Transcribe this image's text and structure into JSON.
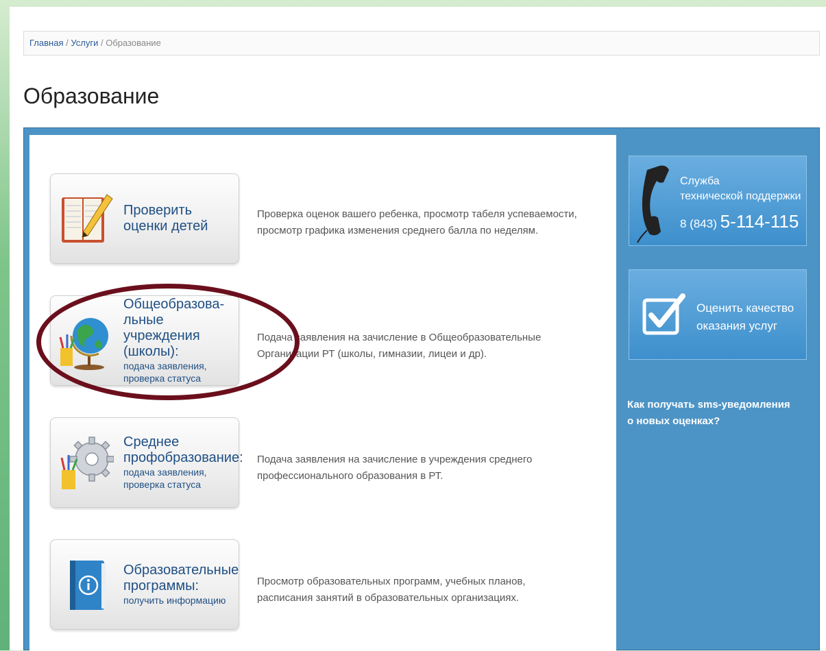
{
  "breadcrumb": {
    "home": "Главная",
    "services": "Услуги",
    "current": "Образование",
    "sep": "/"
  },
  "page_title": "Образование",
  "services": [
    {
      "title": "Проверить оценки детей",
      "line1": "Проверить",
      "line2": "оценки детей",
      "icon": "gradebook-icon",
      "description_line1": "Проверка оценок вашего ребенка, просмотр табеля успеваемости,",
      "description_line2": "просмотр графика изменения среднего балла по неделям."
    },
    {
      "line1": "Общеобразова-",
      "line2": "льные учреждения",
      "line3": "(школы):",
      "sub1": "подача заявления,",
      "sub2": "проверка статуса",
      "icon": "globe-icon",
      "description_line1": "Подача заявления на зачисление в Общеобразовательные",
      "description_line2": "Организации РТ (школы, гимназии, лицеи и др)."
    },
    {
      "line1": "Среднее",
      "line2": "профобразование:",
      "sub1": "подача заявления,",
      "sub2": "проверка статуса",
      "icon": "gear-pencils-icon",
      "description_line1": "Подача заявления на зачисление в учреждения среднего",
      "description_line2": "профессионального образования в РТ."
    },
    {
      "line1": "Образовательные",
      "line2": "программы:",
      "sub1": "получить информацию",
      "icon": "info-book-icon",
      "description_line1": "Просмотр образовательных программ, учебных планов,",
      "description_line2": "расписания занятий в образовательных организациях."
    }
  ],
  "support": {
    "line1": "Служба",
    "line2": "технической поддержки",
    "phone_prefix": "8 (843)",
    "phone_number": "5-114-115",
    "icon": "telephone-icon"
  },
  "quality": {
    "line1": "Оценить качество",
    "line2": "оказания услуг",
    "icon": "checkbox-icon"
  },
  "sms_link": {
    "line1": "Как получать sms-уведомления",
    "line2": "о новых оценках?"
  },
  "colors": {
    "accent_blue": "#4d94c6",
    "link_blue": "#1f4f84",
    "highlight_oval": "#6b0f1c"
  }
}
